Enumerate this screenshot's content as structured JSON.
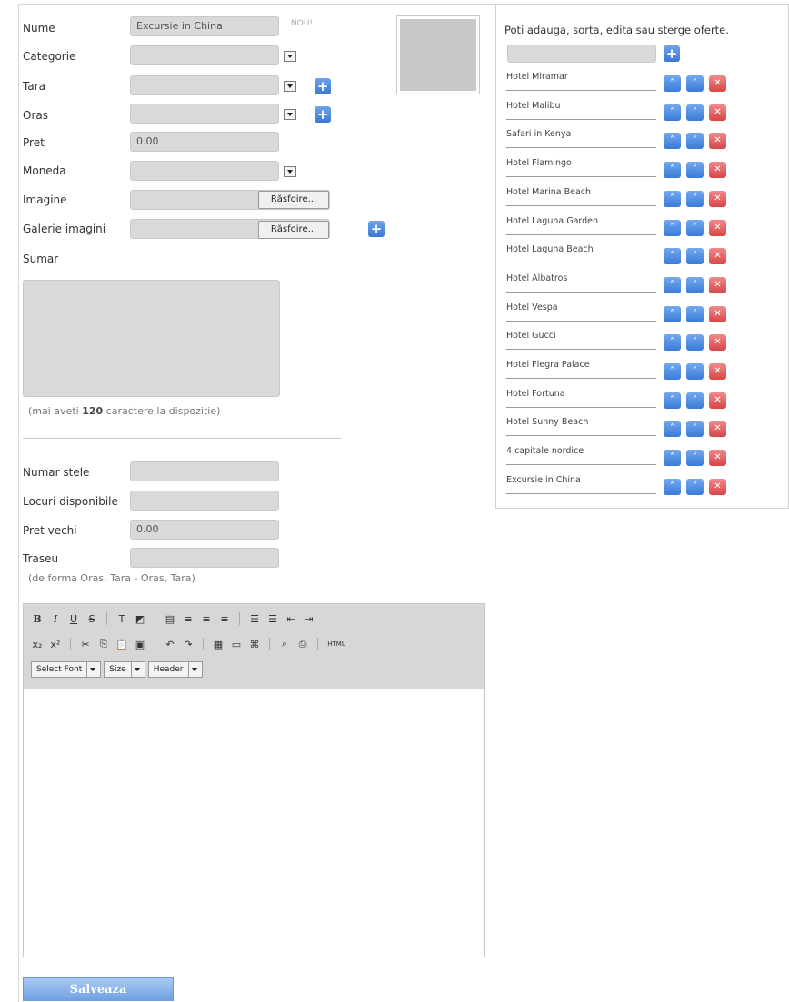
{
  "form": {
    "nume_label": "Nume",
    "nume_value": "Excursie in China",
    "nou_badge": "NOU!",
    "categorie_label": "Categorie",
    "tara_label": "Tara",
    "oras_label": "Oras",
    "pret_label": "Pret",
    "pret_value": "0.00",
    "moneda_label": "Moneda",
    "imagine_label": "Imagine",
    "galerie_label": "Galerie imagini",
    "browse_label": "Răsfoire...",
    "sumar_label": "Sumar",
    "chars_prefix": "(mai aveti",
    "chars_count": "120",
    "chars_suffix": "caractere la dispozitie)",
    "numar_stele_label": "Numar stele",
    "locuri_label": "Locuri disponibile",
    "pret_vechi_label": "Pret vechi",
    "pret_vechi_value": "0.00",
    "traseu_label": "Traseu",
    "traseu_hint": "(de forma Oras, Tara - Oras, Tara)",
    "save_label": "Salveaza"
  },
  "editor": {
    "select_font": "Select Font",
    "size": "Size",
    "header": "Header",
    "html_label": "HTML"
  },
  "offers_panel": {
    "title": "Poti adauga, sorta, edita sau sterge oferte.",
    "items": [
      {
        "label": "Hotel Miramar"
      },
      {
        "label": "Hotel Malibu"
      },
      {
        "label": "Safari in Kenya"
      },
      {
        "label": "Hotel Flamingo"
      },
      {
        "label": "Hotel Marina Beach"
      },
      {
        "label": "Hotel Laguna Garden"
      },
      {
        "label": "Hotel Laguna Beach"
      },
      {
        "label": "Hotel Albatros"
      },
      {
        "label": "Hotel Vespa"
      },
      {
        "label": "Hotel Gucci"
      },
      {
        "label": "Hotel Flegra Palace"
      },
      {
        "label": "Hotel Fortuna"
      },
      {
        "label": "Hotel Sunny Beach"
      },
      {
        "label": "4 capitale nordice"
      },
      {
        "label": "Excursie in China"
      }
    ]
  },
  "colors": {
    "accent_blue": "#3a78d6",
    "delete_red": "#d84545",
    "field_gray": "#d9d9d9"
  }
}
